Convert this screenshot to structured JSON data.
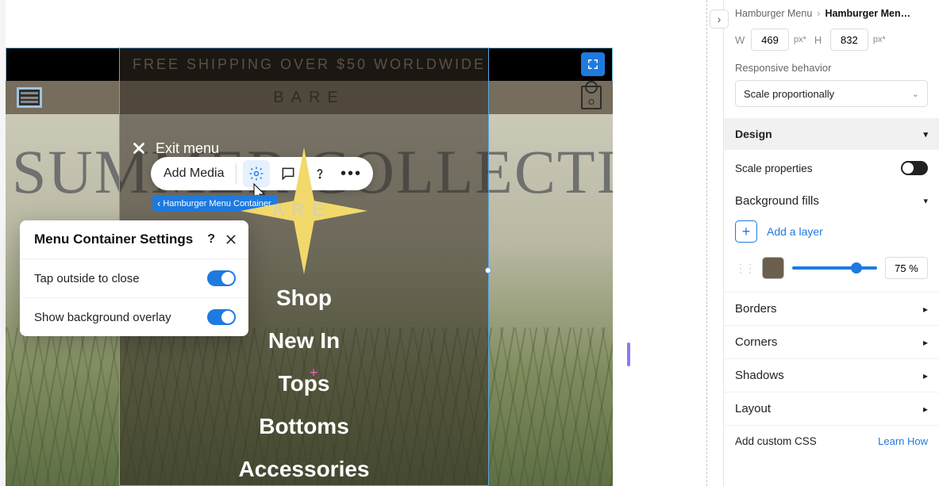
{
  "announce": "FREE SHIPPING OVER $50 WORLDWIDE",
  "brand": "BARE",
  "menu_brand": "ARE",
  "hero_title": "SUMMER COLLECTION",
  "exit_menu": "Exit menu",
  "toolbar": {
    "add_media": "Add Media"
  },
  "tag": "Hamburger Menu Container",
  "menu_items": [
    "Shop",
    "New In",
    "Tops",
    "Bottoms",
    "Accessories"
  ],
  "popup": {
    "title": "Menu Container Settings",
    "tap_outside": "Tap outside to close",
    "show_overlay": "Show background overlay"
  },
  "panel": {
    "crumb1": "Hamburger Menu",
    "crumb2": "Hamburger Men…",
    "W": "469",
    "Wunit": "px*",
    "H": "832",
    "Hunit": "px*",
    "responsive_label": "Responsive behavior",
    "responsive_value": "Scale proportionally",
    "design": "Design",
    "scale_props": "Scale properties",
    "bg_fills": "Background fills",
    "add_layer": "Add a layer",
    "opacity": "75 %",
    "borders": "Borders",
    "corners": "Corners",
    "shadows": "Shadows",
    "layout": "Layout",
    "custom_css": "Add custom CSS",
    "learn_how": "Learn How"
  }
}
